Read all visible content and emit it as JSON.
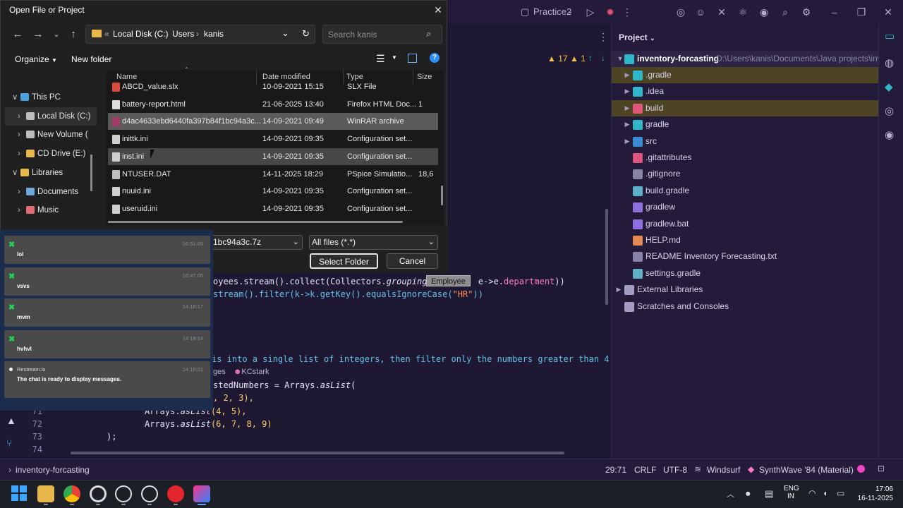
{
  "ide": {
    "project_dropdown": "Practice2",
    "project_panel_title": "Project",
    "warnings": "17",
    "alerts": "1",
    "root_name": "inventory-forcasting",
    "root_path": "D:\\Users\\kanis\\Documents\\Java projects\\invento",
    "tree": [
      {
        "label": ".gradle",
        "depth": 1,
        "arrow": true,
        "color": "#2fb7c9"
      },
      {
        "label": ".idea",
        "depth": 1,
        "arrow": true,
        "color": "#2fb7c9"
      },
      {
        "label": "build",
        "depth": 1,
        "arrow": true,
        "color": "#e0567a"
      },
      {
        "label": "gradle",
        "depth": 1,
        "arrow": true,
        "color": "#2fb7c9"
      },
      {
        "label": "src",
        "depth": 1,
        "arrow": true,
        "color": "#3b8ed6"
      },
      {
        "label": ".gitattributes",
        "depth": 1,
        "arrow": false,
        "color": "#e0567a"
      },
      {
        "label": ".gitignore",
        "depth": 1,
        "arrow": false,
        "color": "#8a83a8"
      },
      {
        "label": "build.gradle",
        "depth": 1,
        "arrow": false,
        "color": "#5fb0c9"
      },
      {
        "label": "gradlew",
        "depth": 1,
        "arrow": false,
        "color": "#8d6fe0"
      },
      {
        "label": "gradlew.bat",
        "depth": 1,
        "arrow": false,
        "color": "#8d6fe0"
      },
      {
        "label": "HELP.md",
        "depth": 1,
        "arrow": false,
        "color": "#e58a55"
      },
      {
        "label": "README Inventory Forecasting.txt",
        "depth": 1,
        "arrow": false,
        "color": "#8a83a8"
      },
      {
        "label": "settings.gradle",
        "depth": 1,
        "arrow": false,
        "color": "#5fb0c9"
      },
      {
        "label": "External Libraries",
        "depth": 0,
        "arrow": true,
        "color": "#a49cc0"
      },
      {
        "label": "Scratches and Consoles",
        "depth": 0,
        "arrow": false,
        "color": "#a49cc0"
      }
    ],
    "code": {
      "line_a_p1": "oyees.stream().collect(Collectors.",
      "line_a_italic": "groupingBy",
      "line_a_p2": "e->e.",
      "line_a_field": "department",
      "line_a_end": "))",
      "line_b_p1": "stream().filter(k->k.getKey().equalsIgnoreCase(",
      "line_b_str": "\"HR\"",
      "line_b_end": "))",
      "comment": "is into a single list of integers, then filter only the numbers greater than 4.",
      "usages": "ges",
      "author": "KCstark",
      "line_c": "stedNumbers = Arrays.",
      "line_c_italic": "asList",
      "line_c_end": "(",
      "line_d": ", 2, 3),",
      "line_71_p1": "Arrays.",
      "line_71_italic": "asList",
      "line_71_p2": "(4, 5),",
      "line_72_p1": "Arrays.",
      "line_72_italic": "asList",
      "line_72_p2": "(6, 7, 8, 9)",
      "line_73": ");",
      "ln71": "71",
      "ln72": "72",
      "ln73": "73",
      "ln74": "74"
    },
    "tooltip": "Employee"
  },
  "status_bar": {
    "project": "inventory-forcasting",
    "position": "29:71",
    "line_ending": "CRLF",
    "encoding": "UTF-8",
    "plugin": "Windsurf",
    "theme": "SynthWave '84 (Material)"
  },
  "dialog": {
    "title": "Open File or Project",
    "breadcrumb_prefix": "«",
    "breadcrumb": [
      "Local Disk (C:)",
      "Users",
      "kanis"
    ],
    "search_placeholder": "Search kanis",
    "organize": "Organize",
    "new_folder": "New folder",
    "columns": {
      "name": "Name",
      "date": "Date modified",
      "type": "Type",
      "size": "Size"
    },
    "nav": [
      {
        "label": "This PC",
        "arrow": "∨",
        "depth": 0,
        "icon": "monitor-icon"
      },
      {
        "label": "Local Disk (C:)",
        "arrow": "›",
        "depth": 1,
        "icon": "drive-icon",
        "selected": true
      },
      {
        "label": "New Volume (",
        "arrow": "›",
        "depth": 1,
        "icon": "drive-icon"
      },
      {
        "label": "CD Drive (E:)",
        "arrow": "›",
        "depth": 1,
        "icon": "cd-icon"
      },
      {
        "label": "Libraries",
        "arrow": "∨",
        "depth": 0,
        "icon": "folder-icon"
      },
      {
        "label": "Documents",
        "arrow": "›",
        "depth": 1,
        "icon": "documents-icon"
      },
      {
        "label": "Music",
        "arrow": "›",
        "depth": 1,
        "icon": "music-icon"
      }
    ],
    "files": [
      {
        "name": "ABCD_value.slx",
        "date": "10-09-2021 15:15",
        "type": "SLX File",
        "size": "",
        "icon_color": "#d94b3b"
      },
      {
        "name": "battery-report.html",
        "date": "21-06-2025 13:40",
        "type": "Firefox HTML Doc...",
        "size": "1",
        "icon_color": "#dddddd"
      },
      {
        "name": "d4ac4633ebd6440fa397b84f1bc94a3c...",
        "date": "14-09-2021 09:49",
        "type": "WinRAR archive",
        "size": "",
        "icon_color": "#a23a6a",
        "selected": true
      },
      {
        "name": "inittk.ini",
        "date": "14-09-2021 09:35",
        "type": "Configuration set...",
        "size": "",
        "icon_color": "#cfcfcf"
      },
      {
        "name": "inst.ini",
        "date": "14-09-2021 09:35",
        "type": "Configuration set...",
        "size": "",
        "icon_color": "#cfcfcf",
        "hover": true
      },
      {
        "name": "NTUSER.DAT",
        "date": "14-11-2025 18:29",
        "type": "PSpice Simulatio...",
        "size": "18,6",
        "icon_color": "#bfbfbf"
      },
      {
        "name": "nuuid.ini",
        "date": "14-09-2021 09:35",
        "type": "Configuration set...",
        "size": "",
        "icon_color": "#cfcfcf"
      },
      {
        "name": "useruid.ini",
        "date": "14-09-2021 09:35",
        "type": "Configuration set...",
        "size": "",
        "icon_color": "#cfcfcf"
      }
    ],
    "filename_value": "1bc94a3c.7z",
    "filetype_value": "All files (*.*)",
    "select_folder": "Select Folder",
    "cancel": "Cancel"
  },
  "chat": {
    "messages": [
      {
        "text": "lol",
        "time": "16:51:05",
        "source": "x"
      },
      {
        "text": "vsvs",
        "time": "16:47:05",
        "source": "x"
      },
      {
        "text": "mvm",
        "time": "14:18:17",
        "source": "x"
      },
      {
        "text": "hvhvl",
        "time": "14:18:14",
        "source": "x"
      }
    ],
    "system": {
      "name": "Restream.io",
      "time": "14:18:01",
      "text": "The chat is ready to display messages."
    }
  },
  "taskbar": {
    "language": "ENG",
    "region": "IN",
    "time": "17:06",
    "date": "16-11-2025"
  }
}
